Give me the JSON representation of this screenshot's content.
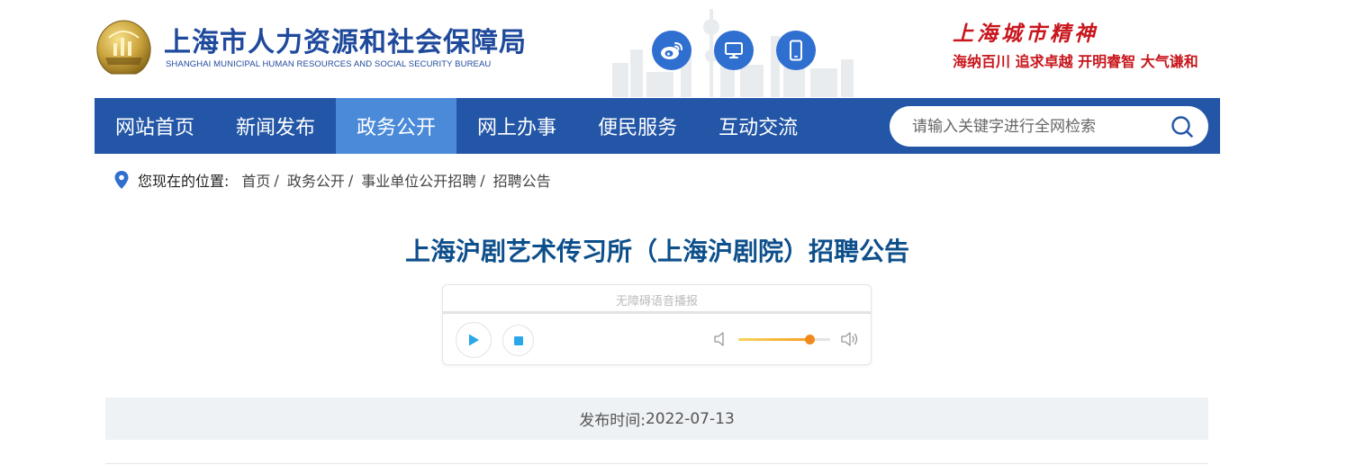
{
  "header": {
    "title": "上海市人力资源和社会保障局",
    "subtitle": "SHANGHAI MUNICIPAL HUMAN RESOURCES AND SOCIAL SECURITY BUREAU",
    "icons": [
      "weibo-icon",
      "desktop-icon",
      "mobile-icon"
    ],
    "spirit_title": "上海城市精神",
    "spirit_slogan": "海纳百川  追求卓越  开明睿智  大气谦和"
  },
  "nav": {
    "items": [
      "网站首页",
      "新闻发布",
      "政务公开",
      "网上办事",
      "便民服务",
      "互动交流"
    ],
    "active_index": 2
  },
  "search": {
    "placeholder": "请输入关键字进行全网检索"
  },
  "breadcrumb": {
    "label": "您现在的位置:",
    "items": [
      "首页",
      "政务公开",
      "事业单位公开招聘",
      "招聘公告"
    ]
  },
  "article": {
    "title": "上海沪剧艺术传习所（上海沪剧院）招聘公告",
    "player": {
      "label": "无障碍语音播报",
      "progress": 0,
      "volume": 0.77
    },
    "publish_label": "发布时间:",
    "publish_date": "2022-07-13"
  },
  "colors": {
    "primary": "#2356a7",
    "nav_active": "#4a8ad9",
    "title": "#0d4f8b",
    "spirit": "#c8161d"
  }
}
